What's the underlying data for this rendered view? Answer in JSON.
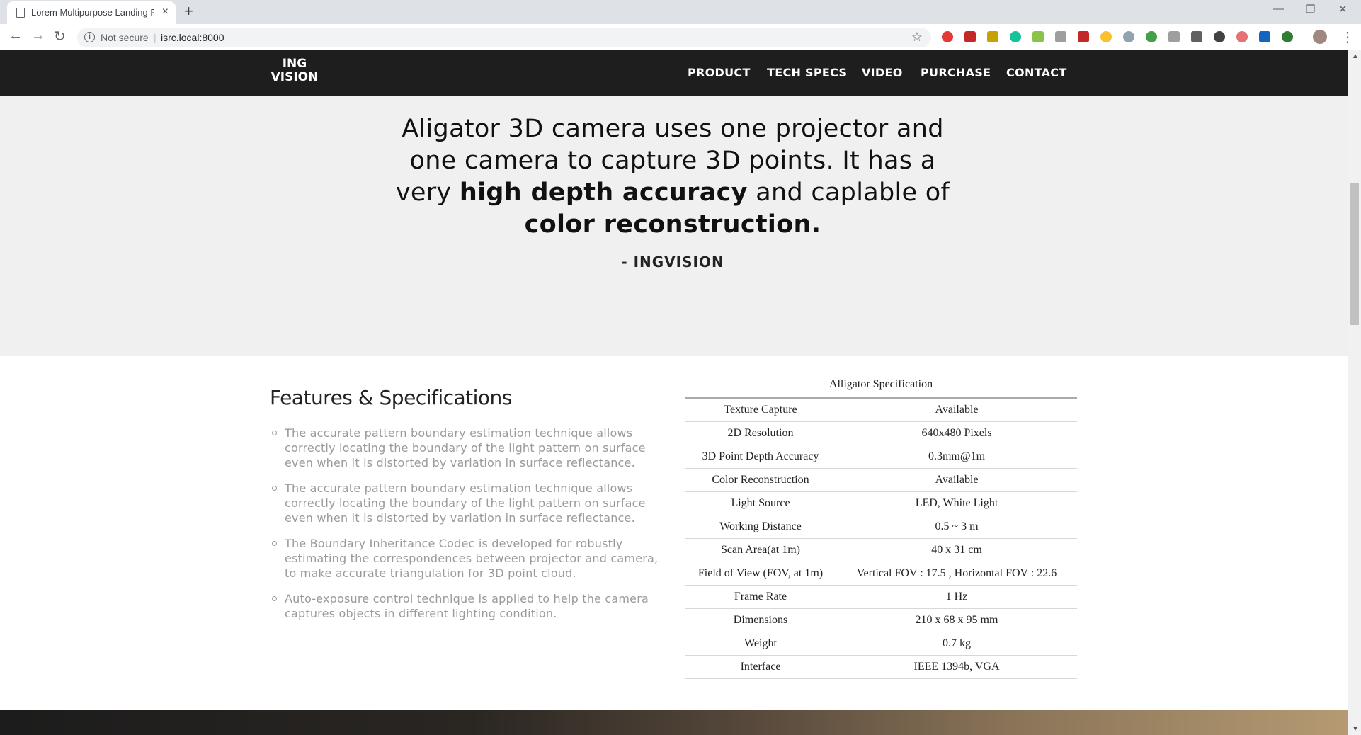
{
  "browser": {
    "tab_title": "Lorem Multipurpose Landing Page",
    "security_label": "Not secure",
    "url": "isrc.local:8000"
  },
  "site": {
    "logo_line1": "ING",
    "logo_line2": "VISION",
    "nav": [
      "PRODUCT",
      "TECH SPECS",
      "VIDEO",
      "PURCHASE",
      "CONTACT"
    ]
  },
  "hero": {
    "quote_part1": "Aligator 3D camera uses one projector and one camera to capture 3D points. It has a very ",
    "quote_bold1": "high depth accuracy",
    "quote_part2": " and caplable of ",
    "quote_bold2": "color reconstruction.",
    "author": "- INGVISION"
  },
  "features": {
    "title": "Features & Specifications",
    "items": [
      "The accurate pattern boundary estimation technique allows correctly locating the boundary of the light pattern on surface even when it is distorted by variation in surface reflectance.",
      "The accurate pattern boundary estimation technique allows correctly locating the boundary of the light pattern on surface even when it is distorted by variation in surface reflectance.",
      "The Boundary Inheritance Codec is developed for robustly estimating the correspondences between projector and camera, to make accurate triangulation for 3D point cloud.",
      "Auto-exposure control technique is applied to help the camera captures objects in different lighting condition."
    ]
  },
  "spec": {
    "caption": "Alligator Specification",
    "rows": [
      {
        "k": "Texture Capture",
        "v": "Available"
      },
      {
        "k": "2D Resolution",
        "v": "640x480 Pixels"
      },
      {
        "k": "3D Point Depth Accuracy",
        "v": "0.3mm@1m"
      },
      {
        "k": "Color Reconstruction",
        "v": "Available"
      },
      {
        "k": "Light Source",
        "v": "LED, White Light"
      },
      {
        "k": "Working Distance",
        "v": "0.5 ~ 3 m"
      },
      {
        "k": "Scan Area(at 1m)",
        "v": "40 x 31 cm"
      },
      {
        "k": "Field of View (FOV, at 1m)",
        "v": "Vertical FOV : 17.5 , Horizontal FOV : 22.6"
      },
      {
        "k": "Frame Rate",
        "v": "1 Hz"
      },
      {
        "k": "Dimensions",
        "v": "210 x 68 x 95 mm"
      },
      {
        "k": "Weight",
        "v": "0.7 kg"
      },
      {
        "k": "Interface",
        "v": "IEEE 1394b, VGA"
      }
    ]
  },
  "colors": {
    "nav_bg": "#1e1e1e",
    "hero_bg": "#f0f0f0",
    "feature_text": "#9a9a9a"
  }
}
